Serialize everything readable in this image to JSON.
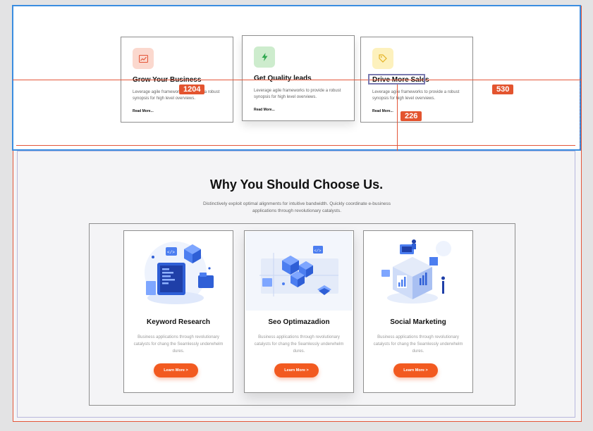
{
  "badges": {
    "width": "1204",
    "height": "530",
    "spacing": "226"
  },
  "features": [
    {
      "title": "Grow Your Business",
      "desc": "Leverage agile frameworks to provide a robust synopsis for high level overviews.",
      "link": "Read More...",
      "icon": "chart-icon",
      "icon_bg": "#fbd8ce",
      "icon_color": "#e4573a"
    },
    {
      "title": "Get Quality leads",
      "desc": "Leverage agile frameworks to provide a robust synopsis for high level overviews.",
      "link": "Read More...",
      "icon": "bolt-icon",
      "icon_bg": "#cdeccd",
      "icon_color": "#2fa84f"
    },
    {
      "title": "Drive More Sales",
      "desc": "Leverage agile frameworks to provide a robust synopsis for high level overviews.",
      "link": "Read More...",
      "icon": "tag-icon",
      "icon_bg": "#fdf1bd",
      "icon_color": "#e4b224"
    }
  ],
  "why": {
    "title": "Why You Should Choose Us.",
    "subtitle": "Distinctively exploit optimal alignments for intuitive bandwidth. Quickly coordinate e-business applications through revolutionary catalysts."
  },
  "services": [
    {
      "title": "Keyword Research",
      "desc": "Business applications through revolutionary catalysts for chang the Seamlessly underwhelm dures.",
      "button": "Learn More >"
    },
    {
      "title": "Seo Optimazadion",
      "desc": "Business applications through revolutionary catalysts for chang the Seamlessly underwhelm dures.",
      "button": "Learn More >"
    },
    {
      "title": "Social Marketing",
      "desc": "Business applications through revolutionary catalysts for chang the Seamlessly underwhelm dures.",
      "button": "Learn More >"
    }
  ],
  "colors": {
    "accent": "#f25a20",
    "guide": "#e4573a",
    "selection": "#3a8de0"
  }
}
